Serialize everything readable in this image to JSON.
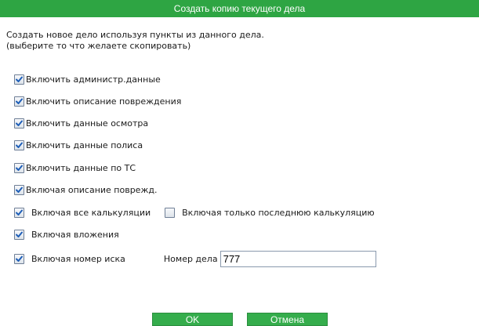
{
  "dialog": {
    "title": "Создать копию текущего дела",
    "intro_line1": "Создать новое дело используя пункты из данного дела.",
    "intro_line2": "(выберите то что желаете скопировать)"
  },
  "options": {
    "admin": {
      "label": "Включить администр.данные",
      "checked": true
    },
    "damage_description": {
      "label": "Включить описание повреждения",
      "checked": true
    },
    "inspection": {
      "label": "Включить данные осмотра",
      "checked": true
    },
    "policy": {
      "label": "Включить данные полиса",
      "checked": true
    },
    "vehicle": {
      "label": "Включить данные по ТС",
      "checked": true
    },
    "damage_desc_short": {
      "label": "Включая описание поврежд.",
      "checked": true
    },
    "all_calculations": {
      "label": "Включая все калькуляции",
      "checked": true
    },
    "last_calculation": {
      "label": "Включая только последнюю калькуляцию",
      "checked": false
    },
    "attachments": {
      "label": "Включая вложения",
      "checked": true
    },
    "claim_number": {
      "label": "Включая номер иска",
      "checked": true
    }
  },
  "case_number": {
    "label": "Номер дела",
    "value": "777"
  },
  "buttons": {
    "ok": "OK",
    "cancel": "Отмена"
  },
  "colors": {
    "accent": "#2ea543",
    "check": "#1f5fb8"
  }
}
